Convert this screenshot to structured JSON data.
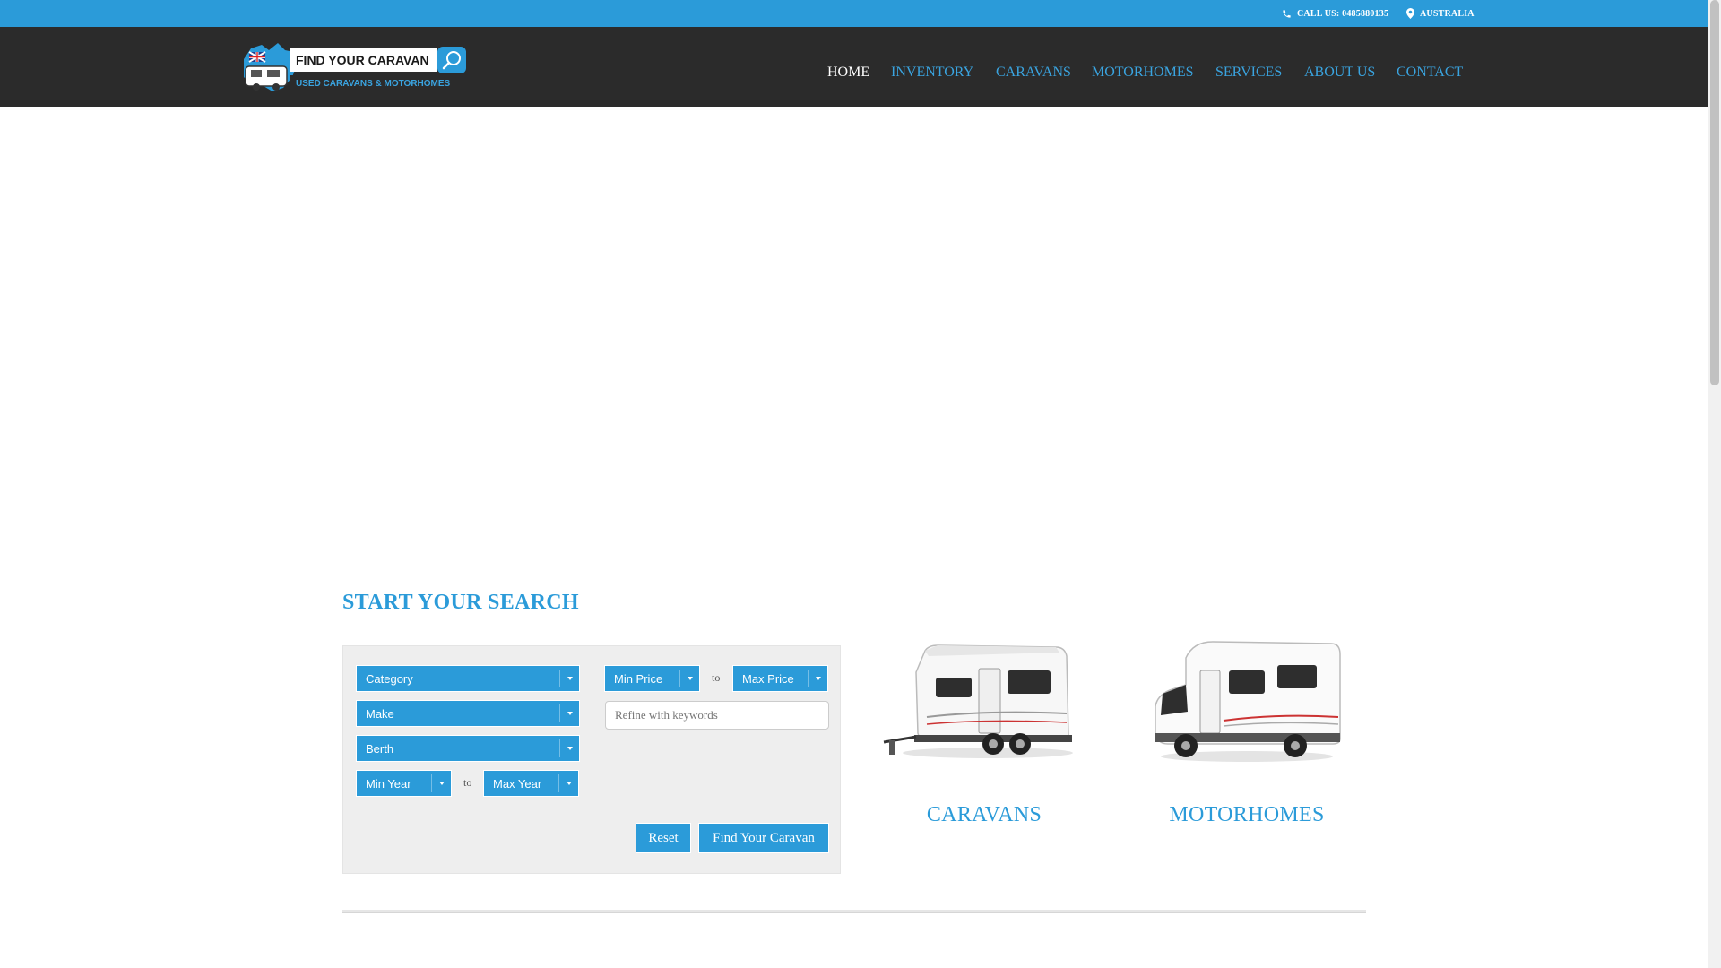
{
  "topbar": {
    "phone_label": "CALL US: 0485880135",
    "location_label": "AUSTRALIA"
  },
  "logo": {
    "title": "FIND YOUR CARAVAN",
    "subtitle": "USED CARAVANS & MOTORHOMES"
  },
  "nav": {
    "items": [
      {
        "label": "HOME"
      },
      {
        "label": "INVENTORY"
      },
      {
        "label": "CARAVANS"
      },
      {
        "label": "MOTORHOMES"
      },
      {
        "label": "SERVICES"
      },
      {
        "label": "ABOUT US"
      },
      {
        "label": "CONTACT"
      }
    ]
  },
  "search": {
    "title": "START YOUR SEARCH",
    "category": "Category",
    "make": "Make",
    "berth": "Berth",
    "min_year": "Min Year",
    "max_year": "Max Year",
    "min_price": "Min Price",
    "max_price": "Max Price",
    "to": "to",
    "keyword_placeholder": "Refine with keywords",
    "reset_label": "Reset",
    "submit_label": "Find Your Caravan"
  },
  "cards": {
    "caravans_label": "CARAVANS",
    "motorhomes_label": "MOTORHOMES"
  },
  "colors": {
    "accent": "#2b9bd9",
    "header_bg": "#2b2b2b",
    "panel_bg": "#eeeeee"
  }
}
